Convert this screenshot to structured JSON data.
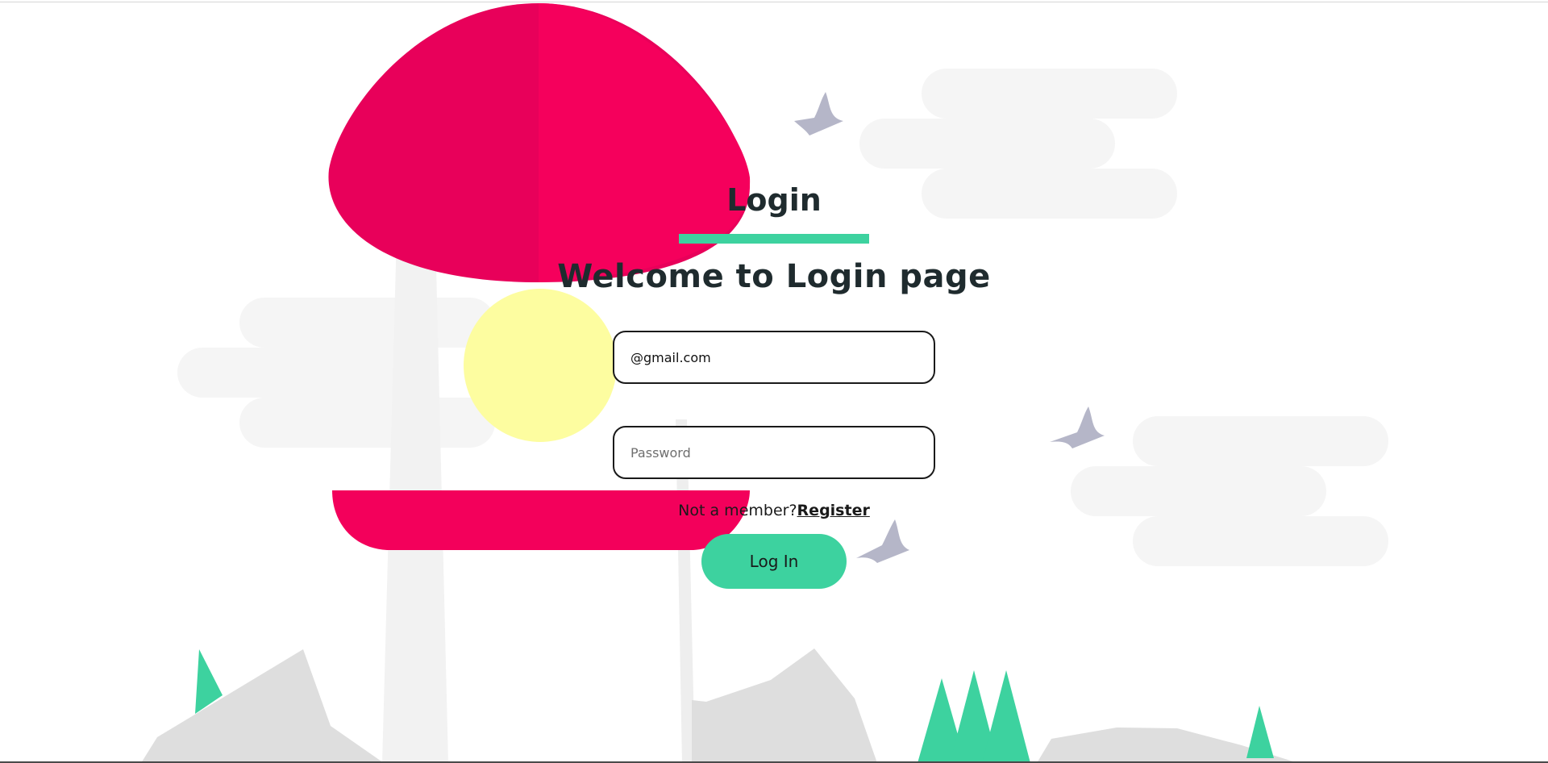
{
  "login": {
    "title": "Login",
    "welcome": "Welcome to Login page",
    "email_value": "@gmail.com",
    "password_placeholder": "Password",
    "not_member_text": "Not a member?",
    "register_label": "Register",
    "login_button_label": "Log In"
  },
  "colors": {
    "accent": "#3dd29f",
    "mushroom_cap": "#f0005a",
    "sun": "#fdfda0",
    "cloud": "#f5f5f5",
    "bird": "#b5b6c8",
    "rock": "#dedede",
    "text": "#1f2b2e"
  },
  "icons": {
    "bird": "bird-icon",
    "tree": "tree-icon"
  }
}
